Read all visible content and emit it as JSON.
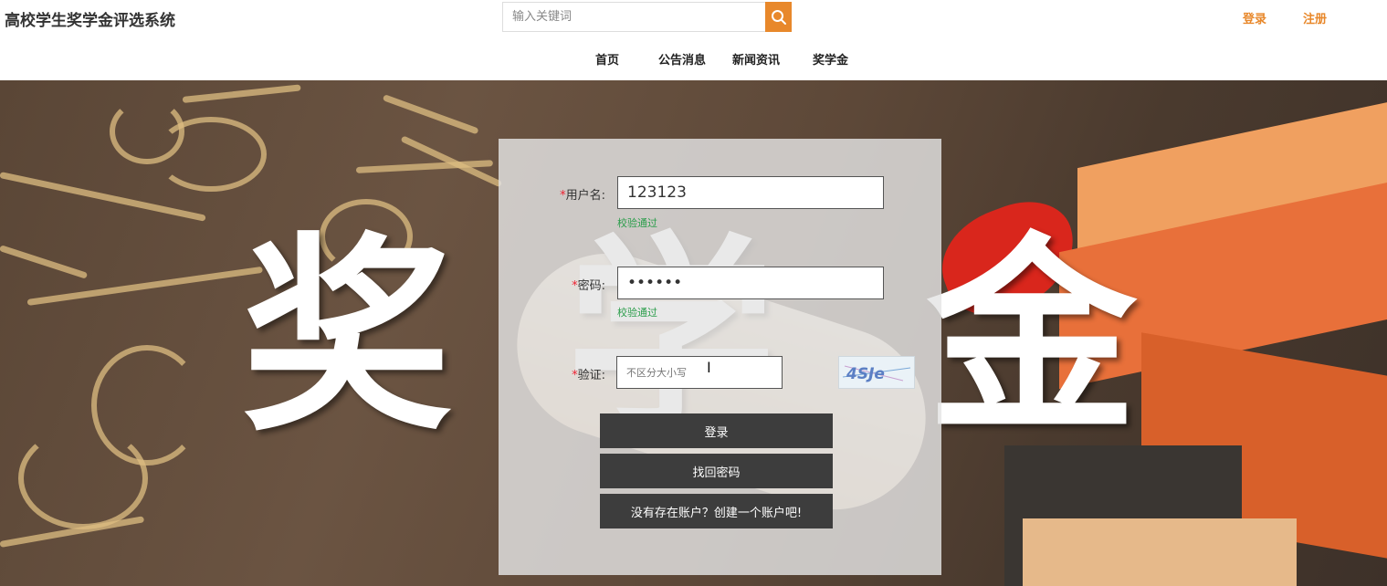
{
  "site": {
    "title": "高校学生奖学金评选系统"
  },
  "search": {
    "placeholder": "输入关键词"
  },
  "top_links": {
    "login": "登录",
    "register": "注册"
  },
  "nav": {
    "home": "首页",
    "notice": "公告消息",
    "news": "新闻资讯",
    "scholarship": "奖学金"
  },
  "hero": {
    "chars": [
      "奖",
      "学",
      "金"
    ]
  },
  "form": {
    "username": {
      "label": "用户名:",
      "value": "123123",
      "hint": "校验通过"
    },
    "password": {
      "label": "密码:",
      "value": "••••••",
      "hint": "校验通过"
    },
    "captcha": {
      "label": "验证:",
      "placeholder": "不区分大小写",
      "text": "4SJe"
    },
    "required_mark": "*",
    "login_button": "登录",
    "recover_button": "找回密码",
    "create_account_button": "没有存在账户？创建一个账户吧!"
  },
  "colors": {
    "accent": "#e8882b",
    "button": "#3d3d3d",
    "hint": "#2a9d4a"
  }
}
